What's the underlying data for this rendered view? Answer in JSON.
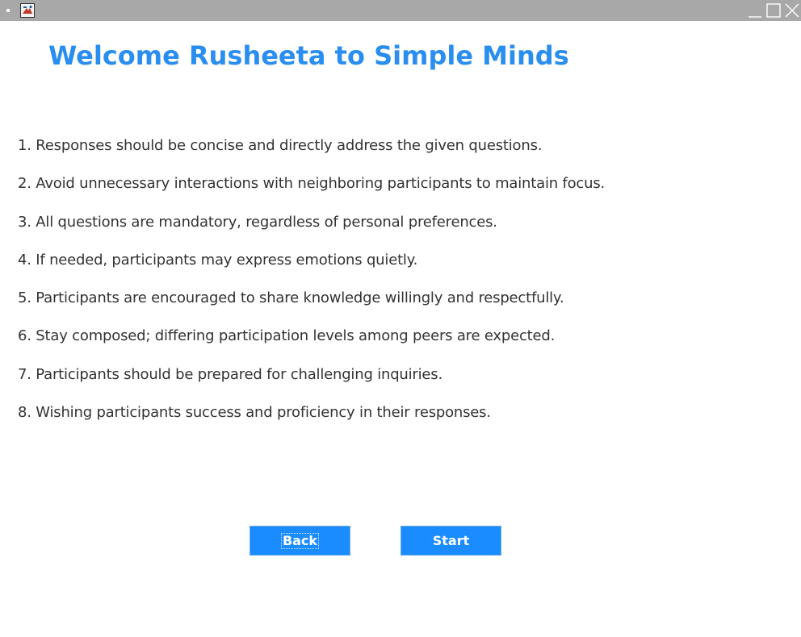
{
  "window": {
    "controls": [
      "minimize-icon",
      "maximize-icon",
      "close-icon"
    ],
    "app_icon": "java-app-icon"
  },
  "header": {
    "title": "Welcome Rusheeta to Simple Minds"
  },
  "rules": [
    "1. Responses should be concise and directly address the given questions.",
    "2. Avoid unnecessary interactions with neighboring participants to maintain focus.",
    "3. All questions are mandatory, regardless of personal preferences.",
    "4. If needed, participants may express emotions quietly.",
    "5. Participants are encouraged to share knowledge willingly and respectfully.",
    "6. Stay composed; differing participation levels among peers are expected.",
    "7. Participants should be prepared for challenging inquiries.",
    "8. Wishing participants success and proficiency in their responses."
  ],
  "buttons": {
    "back_label": "Back",
    "start_label": "Start"
  },
  "colors": {
    "accent": "#2a8ef0",
    "button_bg": "#1a8cff",
    "titlebar_bg": "#a8a8a8",
    "text": "#333333"
  }
}
